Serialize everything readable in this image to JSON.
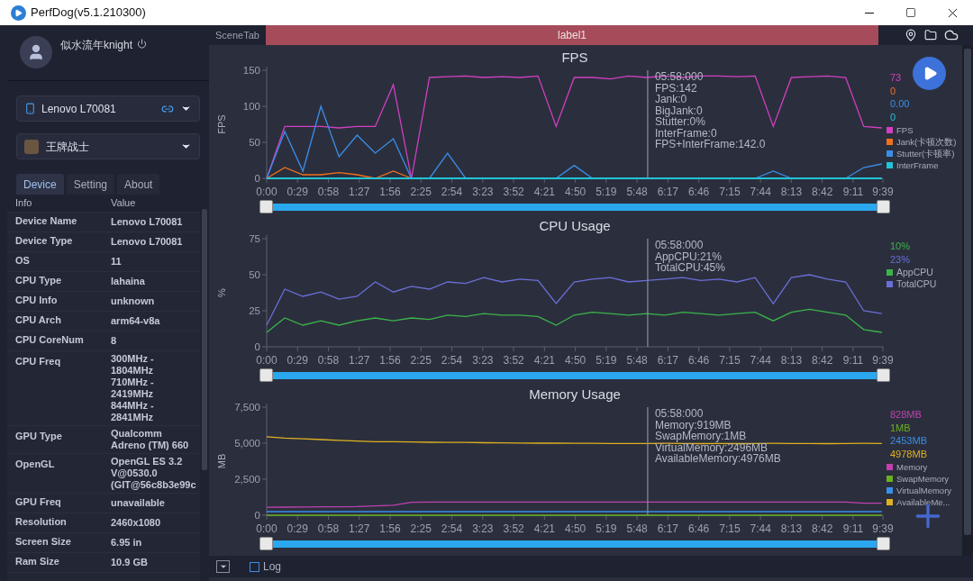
{
  "window": {
    "title": "PerfDog(v5.1.210300)"
  },
  "user": {
    "name": "似水流年knight"
  },
  "device_select": {
    "value": "Lenovo L70081"
  },
  "app_select": {
    "value": "王牌战士"
  },
  "tabs": [
    {
      "label": "Device",
      "selected": true
    },
    {
      "label": "Setting",
      "selected": false
    },
    {
      "label": "About",
      "selected": false
    }
  ],
  "info_table": {
    "columns": [
      "Info",
      "Value"
    ],
    "rows": [
      [
        "Device Name",
        "Lenovo L70081"
      ],
      [
        "Device Type",
        "Lenovo L70081"
      ],
      [
        "OS",
        "11"
      ],
      [
        "CPU Type",
        "lahaina"
      ],
      [
        "CPU Info",
        "unknown"
      ],
      [
        "CPU Arch",
        "arm64-v8a"
      ],
      [
        "CPU CoreNum",
        "8"
      ],
      [
        "CPU Freq",
        "300MHz -\n1804MHz\n710MHz -\n2419MHz\n844MHz -\n2841MHz"
      ],
      [
        "GPU Type",
        "Qualcomm\nAdreno (TM) 660"
      ],
      [
        "OpenGL",
        "OpenGL ES 3.2\nV@0530.0\n(GIT@56c8b3e99c"
      ],
      [
        "GPU Freq",
        "unavailable"
      ],
      [
        "Resolution",
        "2460x1080"
      ],
      [
        "Screen Size",
        "6.95 in"
      ],
      [
        "Ram Size",
        "10.9 GB"
      ]
    ]
  },
  "scene_bar": {
    "label": "SceneTab",
    "marker": "label1"
  },
  "charts": [
    {
      "chart_data": {
        "type": "line",
        "title": "FPS",
        "ylabel": "FPS",
        "xlim": [
          0,
          579
        ],
        "ylim": [
          0,
          150
        ],
        "yticks": [
          0,
          50,
          100,
          150
        ],
        "xticks": [
          {
            "value": 0,
            "label": "0:00"
          },
          {
            "value": 29,
            "label": "0:29"
          },
          {
            "value": 58,
            "label": "0:58"
          },
          {
            "value": 87,
            "label": "1:27"
          },
          {
            "value": 116,
            "label": "1:56"
          },
          {
            "value": 145,
            "label": "2:25"
          },
          {
            "value": 174,
            "label": "2:54"
          },
          {
            "value": 203,
            "label": "3:23"
          },
          {
            "value": 232,
            "label": "3:52"
          },
          {
            "value": 261,
            "label": "4:21"
          },
          {
            "value": 290,
            "label": "4:50"
          },
          {
            "value": 319,
            "label": "5:19"
          },
          {
            "value": 348,
            "label": "5:48"
          },
          {
            "value": 377,
            "label": "6:17"
          },
          {
            "value": 406,
            "label": "6:46"
          },
          {
            "value": 435,
            "label": "7:15"
          },
          {
            "value": 464,
            "label": "7:44"
          },
          {
            "value": 493,
            "label": "8:13"
          },
          {
            "value": 522,
            "label": "8:42"
          },
          {
            "value": 551,
            "label": "9:11"
          },
          {
            "value": 579,
            "label": "9:39"
          }
        ],
        "x": [
          0,
          17,
          34,
          51,
          68,
          85,
          102,
          119,
          136,
          153,
          170,
          187,
          204,
          221,
          238,
          255,
          272,
          289,
          306,
          323,
          340,
          357,
          374,
          391,
          408,
          425,
          442,
          459,
          476,
          493,
          510,
          527,
          544,
          561,
          578
        ],
        "series": [
          {
            "name": "FPS",
            "color": "#d23fc2",
            "values": [
              0,
              72,
              72,
              72,
              70,
              72,
              72,
              130,
              0,
              140,
              141,
              142,
              140,
              141,
              140,
              142,
              72,
              140,
              140,
              138,
              142,
              140,
              142,
              140,
              142,
              142,
              141,
              142,
              72,
              140,
              141,
              142,
              140,
              72,
              70
            ]
          },
          {
            "name": "Jank(卡顿次数)",
            "color": "#f07020",
            "values": [
              0,
              15,
              5,
              5,
              8,
              5,
              0,
              10,
              0,
              null,
              null,
              null,
              null,
              null,
              null,
              null,
              null,
              null,
              null,
              null,
              null,
              null,
              null,
              null,
              null,
              null,
              null,
              null,
              null,
              null,
              null,
              null,
              null,
              null,
              null
            ]
          },
          {
            "name": "Stutter(卡顿率)",
            "color": "#3a8ee8",
            "values": [
              0,
              65,
              10,
              100,
              30,
              60,
              35,
              55,
              0,
              0,
              35,
              0,
              null,
              null,
              null,
              null,
              0,
              18,
              0,
              null,
              null,
              null,
              null,
              null,
              null,
              null,
              null,
              0,
              10,
              0,
              null,
              null,
              0,
              15,
              20
            ]
          },
          {
            "name": "InterFrame",
            "color": "#20c4d8",
            "values": [
              0,
              0,
              0,
              0,
              0,
              0,
              0,
              0,
              0,
              0,
              0,
              0,
              0,
              0,
              0,
              0,
              0,
              0,
              0,
              0,
              0,
              0,
              0,
              0,
              0,
              0,
              0,
              0,
              0,
              0,
              0,
              0,
              0,
              0,
              0
            ]
          }
        ],
        "ref_lines": [
          {
            "axis": "x",
            "value": 358
          }
        ],
        "legend": "right"
      },
      "readout": [
        "05:58:000",
        "FPS:142",
        "Jank:0",
        "BigJank:0",
        "Stutter:0%",
        "InterFrame:0",
        "FPS+InterFrame:142.0"
      ],
      "current_values": [
        "73",
        "0",
        "0.00",
        "0"
      ],
      "time_slider": {
        "level": 1
      }
    },
    {
      "chart_data": {
        "type": "line",
        "title": "CPU Usage",
        "ylabel": "%",
        "xlim": [
          0,
          579
        ],
        "ylim": [
          0,
          75
        ],
        "yticks": [
          0,
          25,
          50,
          75
        ],
        "xticks": [
          {
            "value": 0,
            "label": "0:00"
          },
          {
            "value": 29,
            "label": "0:29"
          },
          {
            "value": 58,
            "label": "0:58"
          },
          {
            "value": 87,
            "label": "1:27"
          },
          {
            "value": 116,
            "label": "1:56"
          },
          {
            "value": 145,
            "label": "2:25"
          },
          {
            "value": 174,
            "label": "2:54"
          },
          {
            "value": 203,
            "label": "3:23"
          },
          {
            "value": 232,
            "label": "3:52"
          },
          {
            "value": 261,
            "label": "4:21"
          },
          {
            "value": 290,
            "label": "4:50"
          },
          {
            "value": 319,
            "label": "5:19"
          },
          {
            "value": 348,
            "label": "5:48"
          },
          {
            "value": 377,
            "label": "6:17"
          },
          {
            "value": 406,
            "label": "6:46"
          },
          {
            "value": 435,
            "label": "7:15"
          },
          {
            "value": 464,
            "label": "7:44"
          },
          {
            "value": 493,
            "label": "8:13"
          },
          {
            "value": 522,
            "label": "8:42"
          },
          {
            "value": 551,
            "label": "9:11"
          },
          {
            "value": 579,
            "label": "9:39"
          }
        ],
        "x": [
          0,
          17,
          34,
          51,
          68,
          85,
          102,
          119,
          136,
          153,
          170,
          187,
          204,
          221,
          238,
          255,
          272,
          289,
          306,
          323,
          340,
          357,
          374,
          391,
          408,
          425,
          442,
          459,
          476,
          493,
          510,
          527,
          544,
          561,
          578
        ],
        "series": [
          {
            "name": "AppCPU",
            "color": "#3cb44a",
            "values": [
              10,
              20,
              15,
              18,
              15,
              18,
              20,
              18,
              20,
              19,
              22,
              21,
              23,
              22,
              22,
              21,
              15,
              22,
              24,
              23,
              22,
              23,
              22,
              24,
              23,
              22,
              23,
              24,
              18,
              24,
              26,
              24,
              22,
              12,
              10
            ]
          },
          {
            "name": "TotalCPU",
            "color": "#6a6fd8",
            "values": [
              15,
              40,
              35,
              38,
              33,
              35,
              45,
              38,
              42,
              40,
              45,
              44,
              48,
              45,
              47,
              46,
              30,
              45,
              47,
              48,
              45,
              46,
              47,
              48,
              46,
              47,
              45,
              48,
              30,
              48,
              50,
              47,
              45,
              25,
              23
            ]
          }
        ],
        "ref_lines": [
          {
            "axis": "x",
            "value": 358
          }
        ],
        "legend": "right"
      },
      "readout": [
        "05:58:000",
        "AppCPU:21%",
        "TotalCPU:45%"
      ],
      "current_values": [
        "10%",
        "23%"
      ],
      "time_slider": {
        "level": 1
      }
    },
    {
      "chart_data": {
        "type": "line",
        "title": "Memory Usage",
        "ylabel": "MB",
        "xlim": [
          0,
          579
        ],
        "ylim": [
          0,
          7500
        ],
        "yticks": [
          {
            "value": 0,
            "label": "0"
          },
          {
            "value": 2500,
            "label": "2,500"
          },
          {
            "value": 5000,
            "label": "5,000"
          },
          {
            "value": 7500,
            "label": "7,500"
          }
        ],
        "xticks": [
          {
            "value": 0,
            "label": "0:00"
          },
          {
            "value": 29,
            "label": "0:29"
          },
          {
            "value": 58,
            "label": "0:58"
          },
          {
            "value": 87,
            "label": "1:27"
          },
          {
            "value": 116,
            "label": "1:56"
          },
          {
            "value": 145,
            "label": "2:25"
          },
          {
            "value": 174,
            "label": "2:54"
          },
          {
            "value": 203,
            "label": "3:23"
          },
          {
            "value": 232,
            "label": "3:52"
          },
          {
            "value": 261,
            "label": "4:21"
          },
          {
            "value": 290,
            "label": "4:50"
          },
          {
            "value": 319,
            "label": "5:19"
          },
          {
            "value": 348,
            "label": "5:48"
          },
          {
            "value": 377,
            "label": "6:17"
          },
          {
            "value": 406,
            "label": "6:46"
          },
          {
            "value": 435,
            "label": "7:15"
          },
          {
            "value": 464,
            "label": "7:44"
          },
          {
            "value": 493,
            "label": "8:13"
          },
          {
            "value": 522,
            "label": "8:42"
          },
          {
            "value": 551,
            "label": "9:11"
          },
          {
            "value": 579,
            "label": "9:39"
          }
        ],
        "x": [
          0,
          17,
          34,
          51,
          68,
          85,
          102,
          119,
          136,
          153,
          170,
          187,
          204,
          221,
          238,
          255,
          272,
          289,
          306,
          323,
          340,
          357,
          374,
          391,
          408,
          425,
          442,
          459,
          476,
          493,
          510,
          527,
          544,
          561,
          578
        ],
        "series": [
          {
            "name": "Memory",
            "color": "#c040b0",
            "values": [
              550,
              560,
              570,
              580,
              590,
              600,
              650,
              700,
              900,
              920,
              920,
              920,
              920,
              920,
              920,
              920,
              910,
              920,
              920,
              920,
              920,
              920,
              920,
              920,
              920,
              920,
              920,
              920,
              920,
              920,
              920,
              920,
              920,
              840,
              830
            ]
          },
          {
            "name": "SwapMemory",
            "color": "#6ab020",
            "values": [
              0,
              0,
              0,
              0,
              0,
              0,
              0,
              0,
              0,
              0,
              0,
              0,
              0,
              0,
              0,
              0,
              0,
              0,
              0,
              0,
              0,
              0,
              0,
              0,
              0,
              0,
              0,
              0,
              0,
              0,
              0,
              0,
              0,
              0,
              0
            ]
          },
          {
            "name": "VirtualMemory",
            "color": "#3a8ee8",
            "values": [
              250,
              250,
              250,
              250,
              250,
              250,
              250,
              250,
              250,
              250,
              250,
              250,
              250,
              250,
              250,
              250,
              250,
              250,
              250,
              250,
              250,
              250,
              250,
              250,
              250,
              250,
              250,
              250,
              250,
              250,
              250,
              250,
              250,
              250,
              250
            ]
          },
          {
            "name": "AvailableMe...",
            "color": "#e0b020",
            "values": [
              5450,
              5350,
              5300,
              5250,
              5200,
              5150,
              5100,
              5100,
              5080,
              5060,
              5050,
              5050,
              5030,
              5020,
              5010,
              5000,
              5000,
              4990,
              4990,
              4980,
              4980,
              4980,
              4990,
              4980,
              4970,
              4980,
              4970,
              4980,
              4990,
              4980,
              4980,
              4970,
              4980,
              4990,
              4980
            ]
          }
        ],
        "ref_lines": [
          {
            "axis": "x",
            "value": 358
          }
        ],
        "legend": "right"
      },
      "readout": [
        "05:58:000",
        "Memory:919MB",
        "SwapMemory:1MB",
        "VirtualMemory:2496MB",
        "AvailableMemory:4976MB"
      ],
      "current_values": [
        "828MB",
        "1MB",
        "2453MB",
        "4978MB"
      ],
      "time_slider": {
        "level": 1
      }
    }
  ],
  "log": {
    "label": "Log",
    "checked": false
  }
}
